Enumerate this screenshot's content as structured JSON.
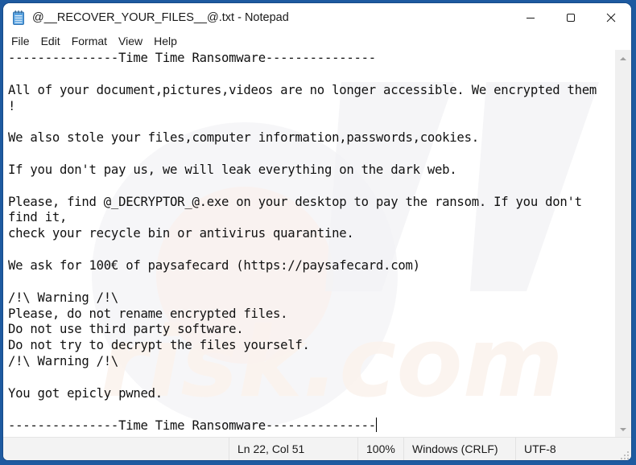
{
  "window": {
    "title": "@__RECOVER_YOUR_FILES__@.txt - Notepad",
    "app_icon": "notepad-icon",
    "caption_buttons": {
      "minimize": "minimize-icon",
      "maximize": "maximize-icon",
      "close": "close-icon"
    }
  },
  "menu": {
    "items": [
      {
        "label": "File"
      },
      {
        "label": "Edit"
      },
      {
        "label": "Format"
      },
      {
        "label": "View"
      },
      {
        "label": "Help"
      }
    ]
  },
  "editor": {
    "lines": [
      "---------------Time Time Ransomware---------------",
      "",
      "All of your document,pictures,videos are no longer accessible. We encrypted them",
      "!",
      "",
      "We also stole your files,computer information,passwords,cookies.",
      "",
      "If you don't pay us, we will leak everything on the dark web.",
      "",
      "Please, find @_DECRYPTOR_@.exe on your desktop to pay the ransom. If you don't",
      "find it,",
      "check your recycle bin or antivirus quarantine.",
      "",
      "We ask for 100€ of paysafecard (https://paysafecard.com)",
      "",
      "/!\\ Warning /!\\",
      "Please, do not rename encrypted files.",
      "Do not use third party software.",
      "Do not try to decrypt the files yourself.",
      "/!\\ Warning /!\\",
      "",
      "You got epicly pwned.",
      "",
      "---------------Time Time Ransomware---------------"
    ]
  },
  "statusbar": {
    "position": "Ln 22, Col 51",
    "zoom": "100%",
    "line_ending": "Windows (CRLF)",
    "encoding": "UTF-8"
  },
  "colors": {
    "desktop_accent": "#1e5aa0",
    "window_bg": "#f3f3f3",
    "editor_bg": "#ffffff",
    "text": "#111111"
  }
}
